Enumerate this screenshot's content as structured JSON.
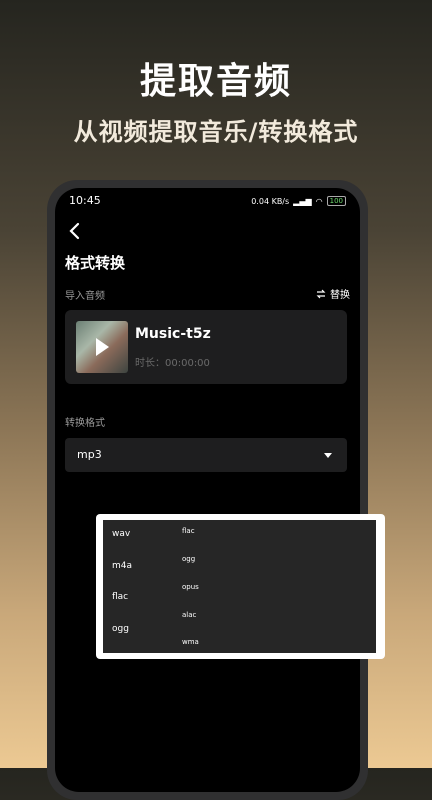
{
  "promo": {
    "title": "提取音频",
    "subtitle": "从视频提取音乐/转换格式"
  },
  "status_bar": {
    "time": "10:45",
    "net_speed": "0.04 KB/s",
    "battery": "100"
  },
  "header": {
    "title": "格式转换"
  },
  "import_section": {
    "label": "导入音频",
    "replace_label": "替换"
  },
  "audio": {
    "name": "Music-t5z",
    "duration": "时长：00:00:00"
  },
  "convert_section": {
    "label": "转换格式",
    "selected": "mp3"
  },
  "dropdown": {
    "left_options": [
      "wav",
      "m4a",
      "flac",
      "ogg"
    ],
    "right_options": [
      "flac",
      "ogg",
      "opus",
      "alac",
      "wma"
    ]
  }
}
